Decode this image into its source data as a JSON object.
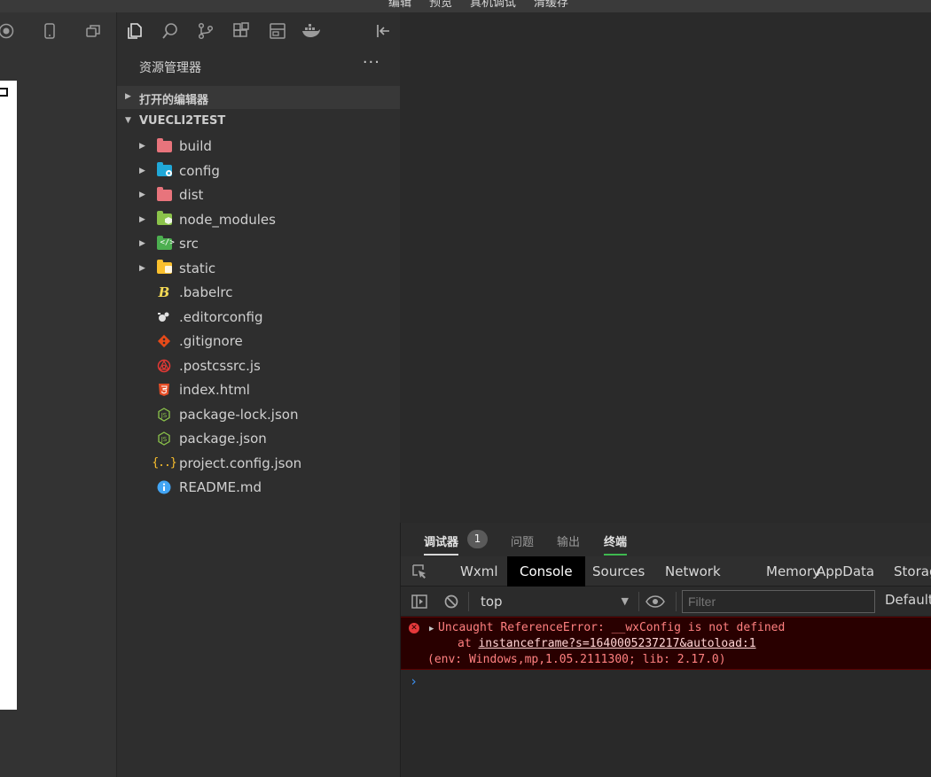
{
  "titlebar": {
    "menus": [
      "编辑",
      "预览",
      "真机调试",
      "清缓存"
    ]
  },
  "simulator": {
    "toolbar_icons": [
      "record-icon",
      "phone-icon",
      "window-icon"
    ]
  },
  "activity_bar": {
    "icons": [
      "files-icon",
      "search-icon",
      "source-control-icon",
      "extensions-icon",
      "layout-icon",
      "docker-icon",
      "collapse-panel-icon"
    ]
  },
  "explorer": {
    "title": "资源管理器",
    "more": "···",
    "sections": {
      "open_editors": "打开的编辑器",
      "project": "VUECLI2TEST"
    },
    "items": [
      {
        "name": "build",
        "type": "folder",
        "icon": "folder-red",
        "color": "#e8747c"
      },
      {
        "name": "config",
        "type": "folder",
        "icon": "folder-config",
        "color": "#20a8d8"
      },
      {
        "name": "dist",
        "type": "folder",
        "icon": "folder-red",
        "color": "#e8747c"
      },
      {
        "name": "node_modules",
        "type": "folder",
        "icon": "folder-node",
        "color": "#8bc34a"
      },
      {
        "name": "src",
        "type": "folder",
        "icon": "folder-src",
        "color": "#4caf50"
      },
      {
        "name": "static",
        "type": "folder",
        "icon": "folder-static",
        "color": "#fbc02d"
      },
      {
        "name": ".babelrc",
        "type": "file",
        "icon": "babel-icon",
        "color": "#f5da55"
      },
      {
        "name": ".editorconfig",
        "type": "file",
        "icon": "editorconfig-icon",
        "color": "#e0e0e0"
      },
      {
        "name": ".gitignore",
        "type": "file",
        "icon": "git-icon",
        "color": "#e64a19"
      },
      {
        "name": ".postcssrc.js",
        "type": "file",
        "icon": "postcss-icon",
        "color": "#e53935"
      },
      {
        "name": "index.html",
        "type": "file",
        "icon": "html-icon",
        "color": "#e44d26"
      },
      {
        "name": "package-lock.json",
        "type": "file",
        "icon": "nodejs-icon",
        "color": "#8bc34a"
      },
      {
        "name": "package.json",
        "type": "file",
        "icon": "nodejs-icon",
        "color": "#8bc34a"
      },
      {
        "name": "project.config.json",
        "type": "file",
        "icon": "json-icon",
        "color": "#fbc02d"
      },
      {
        "name": "README.md",
        "type": "file",
        "icon": "info-icon",
        "color": "#42a5f5"
      }
    ]
  },
  "devtools": {
    "tabs": [
      {
        "label": "调试器",
        "active": true
      },
      {
        "label": "问题"
      },
      {
        "label": "输出"
      },
      {
        "label": "终端"
      }
    ],
    "badge": "1",
    "panel_tabs": [
      "Wxml",
      "Console",
      "Sources",
      "Network",
      "Memory",
      "AppData",
      "Storag"
    ],
    "active_panel": "Console",
    "console": {
      "context": "top",
      "filter_placeholder": "Filter",
      "levels": "Default",
      "error": {
        "line1": "Uncaught ReferenceError: __wxConfig is not defined",
        "line2_prefix": "at ",
        "line2_link": "instanceframe?s=1640005237217&autoload:1",
        "line3": "(env: Windows,mp,1.05.2111300; lib: 2.17.0)"
      },
      "prompt": "›"
    }
  },
  "colors": {
    "accent_terminal": "#3fb950",
    "error_bg": "#290000",
    "error_text": "#ff8080"
  }
}
